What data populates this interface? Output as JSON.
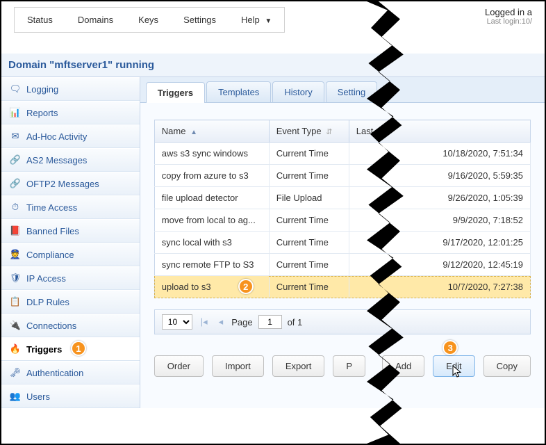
{
  "menu": {
    "status": "Status",
    "domains": "Domains",
    "keys": "Keys",
    "settings": "Settings",
    "help": "Help"
  },
  "login": {
    "line1": "Logged in a",
    "line2": "Last login:10/"
  },
  "domain_status": "Domain \"mftserver1\" running",
  "sidebar": {
    "items": [
      {
        "label": "Logging",
        "icon": "🗨"
      },
      {
        "label": "Reports",
        "icon": "📊"
      },
      {
        "label": "Ad-Hoc Activity",
        "icon": "✉"
      },
      {
        "label": "AS2 Messages",
        "icon": "🔗"
      },
      {
        "label": "OFTP2 Messages",
        "icon": "🔗"
      },
      {
        "label": "Time Access",
        "icon": "⏱"
      },
      {
        "label": "Banned Files",
        "icon": "📕"
      },
      {
        "label": "Compliance",
        "icon": "👮"
      },
      {
        "label": "IP Access",
        "icon": "🛡"
      },
      {
        "label": "DLP Rules",
        "icon": "📋"
      },
      {
        "label": "Connections",
        "icon": "🔌"
      },
      {
        "label": "Triggers",
        "icon": "🔥"
      },
      {
        "label": "Authentication",
        "icon": "🗝"
      },
      {
        "label": "Users",
        "icon": "👥"
      }
    ]
  },
  "tabs": {
    "triggers": "Triggers",
    "templates": "Templates",
    "history": "History",
    "setting": "Setting"
  },
  "grid": {
    "col_name": "Name",
    "col_event": "Event Type",
    "col_last": "Last ",
    "rows": [
      {
        "name": "aws s3 sync windows",
        "event": "Current Time",
        "last": "10/18/2020, 7:51:34"
      },
      {
        "name": "copy from azure to s3",
        "event": "Current Time",
        "last": "9/16/2020, 5:59:35"
      },
      {
        "name": "file upload detector",
        "event": "File Upload",
        "last": "9/26/2020, 1:05:39"
      },
      {
        "name": "move from local to ag...",
        "event": "Current Time",
        "last": "9/9/2020, 7:18:52"
      },
      {
        "name": "sync local with s3",
        "event": "Current Time",
        "last": "9/17/2020, 12:01:25"
      },
      {
        "name": "sync remote FTP to S3",
        "event": "Current Time",
        "last": "9/12/2020, 12:45:19"
      },
      {
        "name": "upload to s3",
        "event": "Current Time",
        "last": "10/7/2020, 7:27:38"
      }
    ]
  },
  "pager": {
    "size": "10",
    "page_label": "Page",
    "page_val": "1",
    "of_label": "of 1"
  },
  "buttons": {
    "order": "Order",
    "import": "Import",
    "export": "Export",
    "p": "P",
    "add": "Add",
    "edit": "Edit",
    "copy": "Copy"
  },
  "markers": {
    "m1": "1",
    "m2": "2",
    "m3": "3"
  }
}
